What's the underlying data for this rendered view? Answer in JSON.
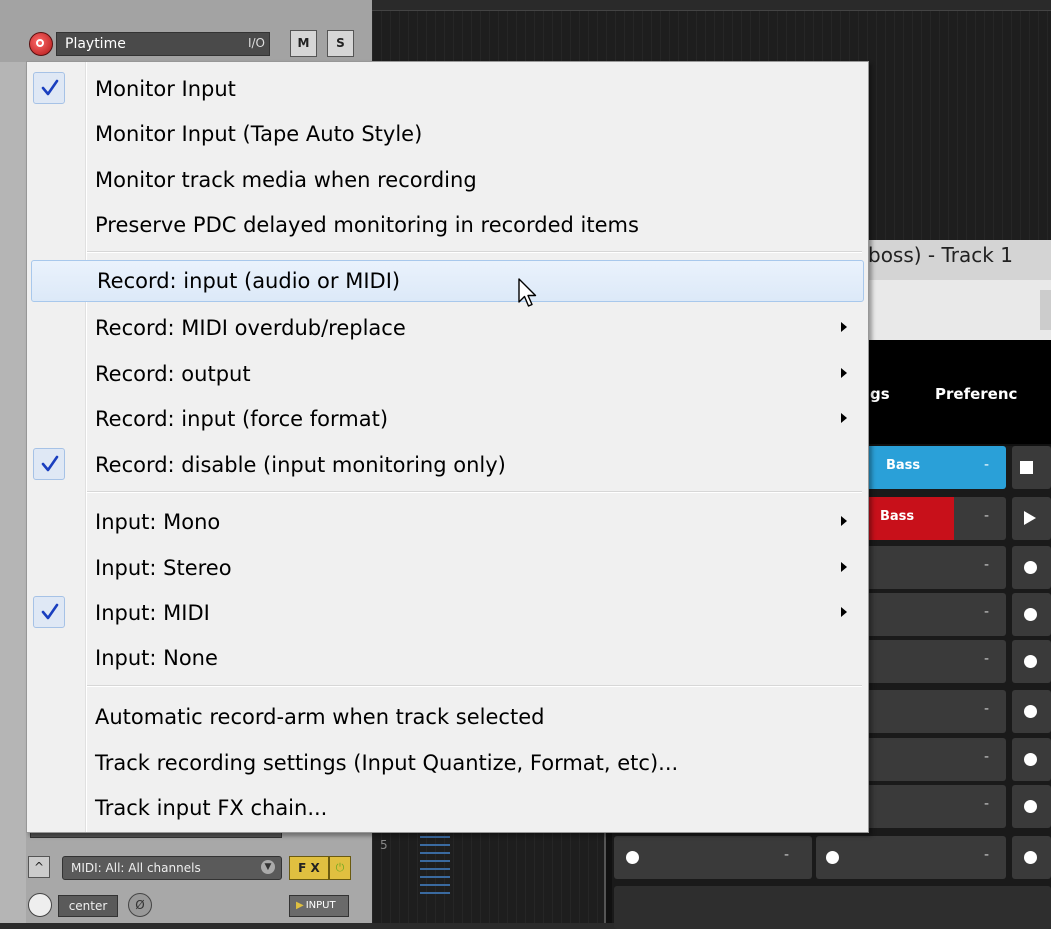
{
  "track": {
    "name": "Playtime",
    "io_label": "I/O",
    "mute_label": "M",
    "solo_label": "S",
    "midi_input": "MIDI: All: All channels",
    "fx_label": "F X",
    "power_glyph": "⏻",
    "pan_label": "center",
    "phase_glyph": "Ø",
    "input_label": "INPUT"
  },
  "arrange": {
    "track_number": "5"
  },
  "plugin": {
    "title": "boss) - Track 1",
    "tabs": [
      "gs",
      "Preferenc"
    ],
    "cells": {
      "bass_blue": "Bass",
      "bass_red": "Bass",
      "dash": "-"
    }
  },
  "menu": {
    "items": [
      {
        "label": "Monitor Input",
        "checked": true,
        "submenu": false
      },
      {
        "label": "Monitor Input (Tape Auto Style)",
        "checked": false,
        "submenu": false
      },
      {
        "label": "Monitor track media when recording",
        "checked": false,
        "submenu": false
      },
      {
        "label": "Preserve PDC delayed monitoring in recorded items",
        "checked": false,
        "submenu": false
      },
      {
        "label": "Record: input (audio or MIDI)",
        "checked": false,
        "submenu": false,
        "hovered": true
      },
      {
        "label": "Record: MIDI overdub/replace",
        "checked": false,
        "submenu": true
      },
      {
        "label": "Record: output",
        "checked": false,
        "submenu": true
      },
      {
        "label": "Record: input (force format)",
        "checked": false,
        "submenu": true
      },
      {
        "label": "Record: disable (input monitoring only)",
        "checked": true,
        "submenu": false
      },
      {
        "label": "Input: Mono",
        "checked": false,
        "submenu": true
      },
      {
        "label": "Input: Stereo",
        "checked": false,
        "submenu": true
      },
      {
        "label": "Input: MIDI",
        "checked": true,
        "submenu": true
      },
      {
        "label": "Input: None",
        "checked": false,
        "submenu": false
      },
      {
        "label": "Automatic record-arm when track selected",
        "checked": false,
        "submenu": false
      },
      {
        "label": "Track recording settings (Input Quantize, Format, etc)...",
        "checked": false,
        "submenu": false
      },
      {
        "label": "Track input FX chain...",
        "checked": false,
        "submenu": false
      }
    ]
  },
  "colors": {
    "check": "#1a3fbf",
    "cell_blue": "#2aa0d8",
    "cell_red": "#c8101a",
    "record": "#d02020"
  },
  "icons": {
    "check": "checkmark-icon",
    "submenu": "submenu-arrow-icon",
    "cursor": "mouse-pointer-icon"
  }
}
